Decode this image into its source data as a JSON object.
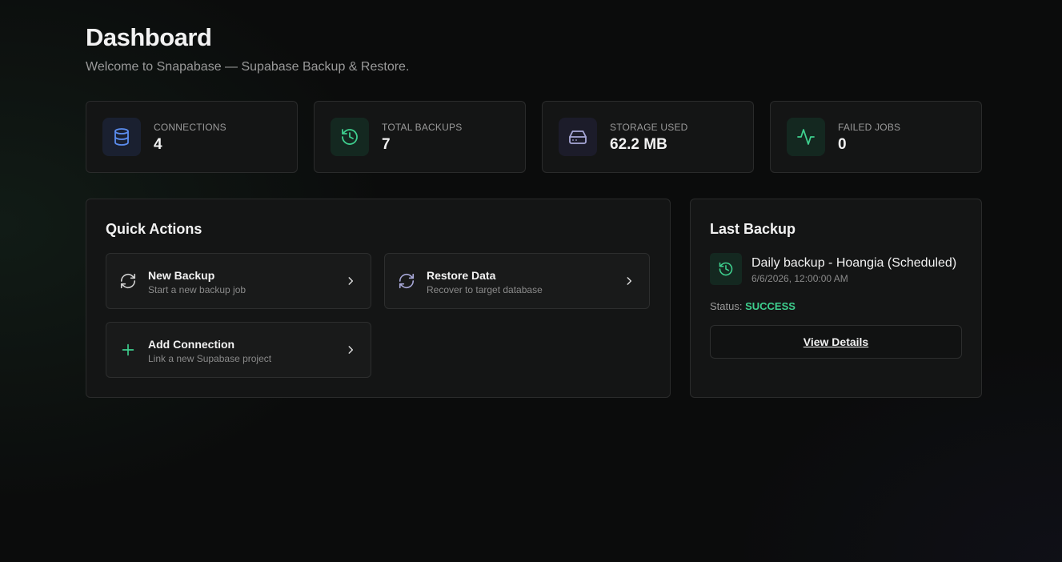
{
  "header": {
    "title": "Dashboard",
    "subtitle": "Welcome to Snapabase — Supabase Backup & Restore."
  },
  "stats": [
    {
      "label": "CONNECTIONS",
      "value": "4",
      "icon": "database-icon",
      "color": "#5b8def"
    },
    {
      "label": "TOTAL BACKUPS",
      "value": "7",
      "icon": "history-icon",
      "color": "#3ecf8e"
    },
    {
      "label": "STORAGE USED",
      "value": "62.2 MB",
      "icon": "hard-drive-icon",
      "color": "#a8a8d8"
    },
    {
      "label": "FAILED JOBS",
      "value": "0",
      "icon": "activity-icon",
      "color": "#3ecf8e"
    }
  ],
  "quick_actions": {
    "title": "Quick Actions",
    "items": [
      {
        "title": "New Backup",
        "desc": "Start a new backup job",
        "icon": "refresh-icon"
      },
      {
        "title": "Restore Data",
        "desc": "Recover to target database",
        "icon": "refresh-icon"
      },
      {
        "title": "Add Connection",
        "desc": "Link a new Supabase project",
        "icon": "plus-icon"
      }
    ]
  },
  "last_backup": {
    "title": "Last Backup",
    "name": "Daily backup - Hoangia (Scheduled)",
    "date": "6/6/2026, 12:00:00 AM",
    "status_label": "Status:",
    "status_value": "SUCCESS",
    "button_label": "View Details"
  },
  "colors": {
    "accent_green": "#3ecf8e",
    "accent_blue": "#5b8def",
    "accent_purple": "#a8a8d8"
  }
}
